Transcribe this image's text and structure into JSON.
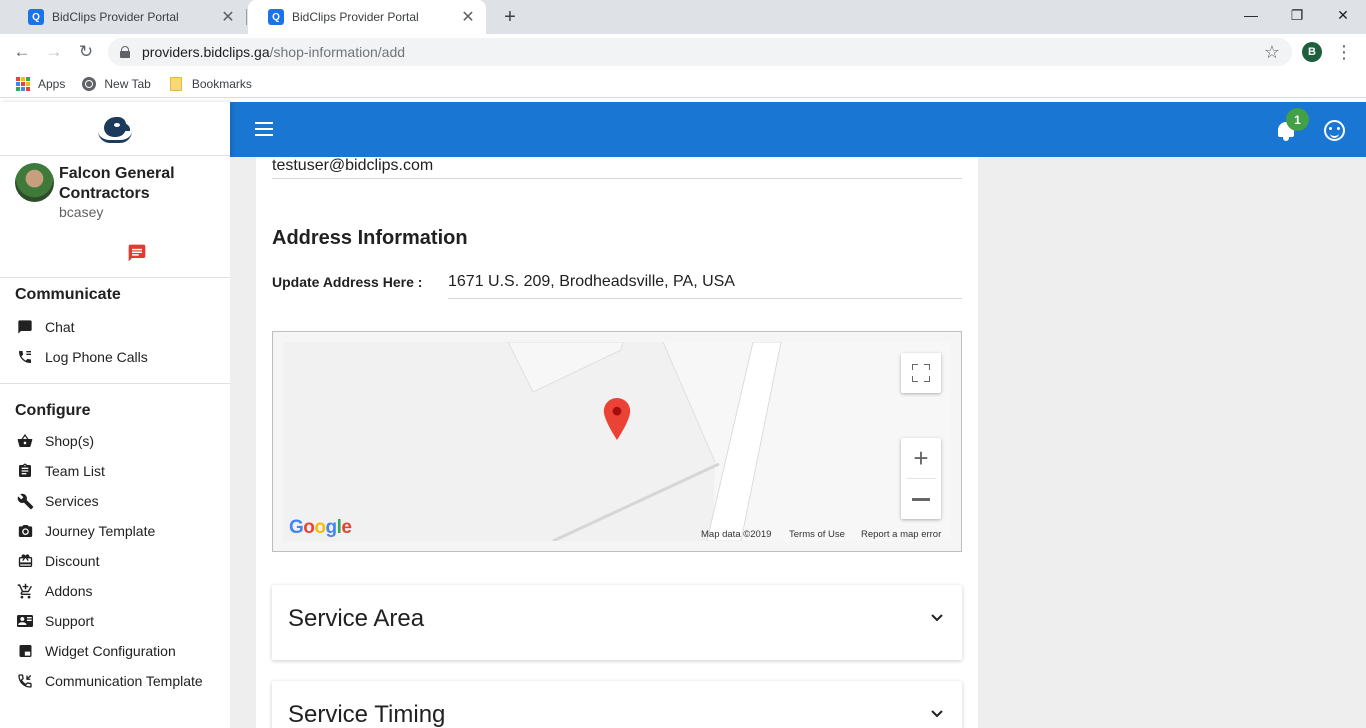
{
  "browser": {
    "tabs": [
      {
        "title": "BidClips Provider Portal",
        "favicon": "Q",
        "active": false
      },
      {
        "title": "BidClips Provider Portal",
        "favicon": "Q",
        "active": true
      }
    ],
    "url_host": "providers.bidclips.ga",
    "url_path": "/shop-information/add",
    "profile_initial": "B",
    "bookmarks": [
      "Apps",
      "New Tab",
      "Bookmarks"
    ]
  },
  "header": {
    "notification_count": "1"
  },
  "sidebar": {
    "company_name": "Falcon General Contractors",
    "username": "bcasey",
    "sections": [
      {
        "title": "Communicate",
        "items": [
          "Chat",
          "Log Phone Calls"
        ]
      },
      {
        "title": "Configure",
        "items": [
          "Shop(s)",
          "Team List",
          "Services",
          "Journey Template",
          "Discount",
          "Addons",
          "Support",
          "Widget Configuration",
          "Communication Template"
        ]
      }
    ]
  },
  "main": {
    "email": "testuser@bidclips.com",
    "address_heading": "Address Information",
    "address_label": "Update Address Here :",
    "address_value": "1671 U.S. 209, Brodheadsville, PA, USA",
    "map": {
      "google_logo": "Google",
      "map_data": "Map data ©2019",
      "terms": "Terms of Use",
      "report": "Report a map error"
    },
    "accordions": [
      "Service Area",
      "Service Timing"
    ]
  },
  "colors": {
    "header_blue": "#1976d2",
    "badge_green": "#43a047",
    "map_pin_red": "#ea4335",
    "message_icon_red": "#e53935"
  }
}
